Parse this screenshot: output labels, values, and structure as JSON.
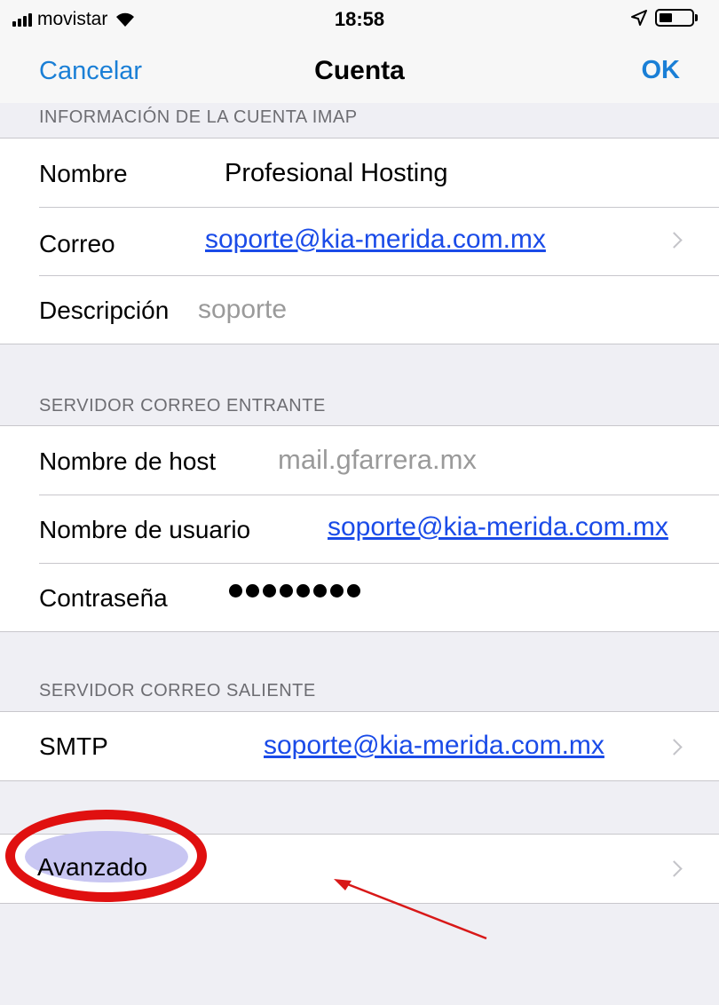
{
  "status_bar": {
    "carrier": "movistar",
    "time": "18:58"
  },
  "nav": {
    "cancel": "Cancelar",
    "title": "Cuenta",
    "ok": "OK"
  },
  "imap_section": {
    "header": "INFORMACIÓN DE LA CUENTA IMAP",
    "nombre_label": "Nombre",
    "nombre_value": "Profesional Hosting",
    "correo_label": "Correo",
    "correo_value": "soporte@kia-merida.com.mx",
    "descripcion_label": "Descripción",
    "descripcion_value": "soporte"
  },
  "incoming_section": {
    "header": "SERVIDOR CORREO ENTRANTE",
    "host_label": "Nombre de host",
    "host_value": "mail.gfarrera.mx",
    "user_label": "Nombre de usuario",
    "user_value": "soporte@kia-merida.com.mx",
    "password_label": "Contraseña",
    "password_dots": 8
  },
  "outgoing_section": {
    "header": "SERVIDOR CORREO SALIENTE",
    "smtp_label": "SMTP",
    "smtp_value": "soporte@kia-merida.com.mx"
  },
  "advanced": {
    "label": "Avanzado"
  },
  "colors": {
    "accent": "#1a7fd6",
    "link": "#1a4be8",
    "annotation_red": "#e01010",
    "highlight_fill": "#c8c6f2"
  }
}
